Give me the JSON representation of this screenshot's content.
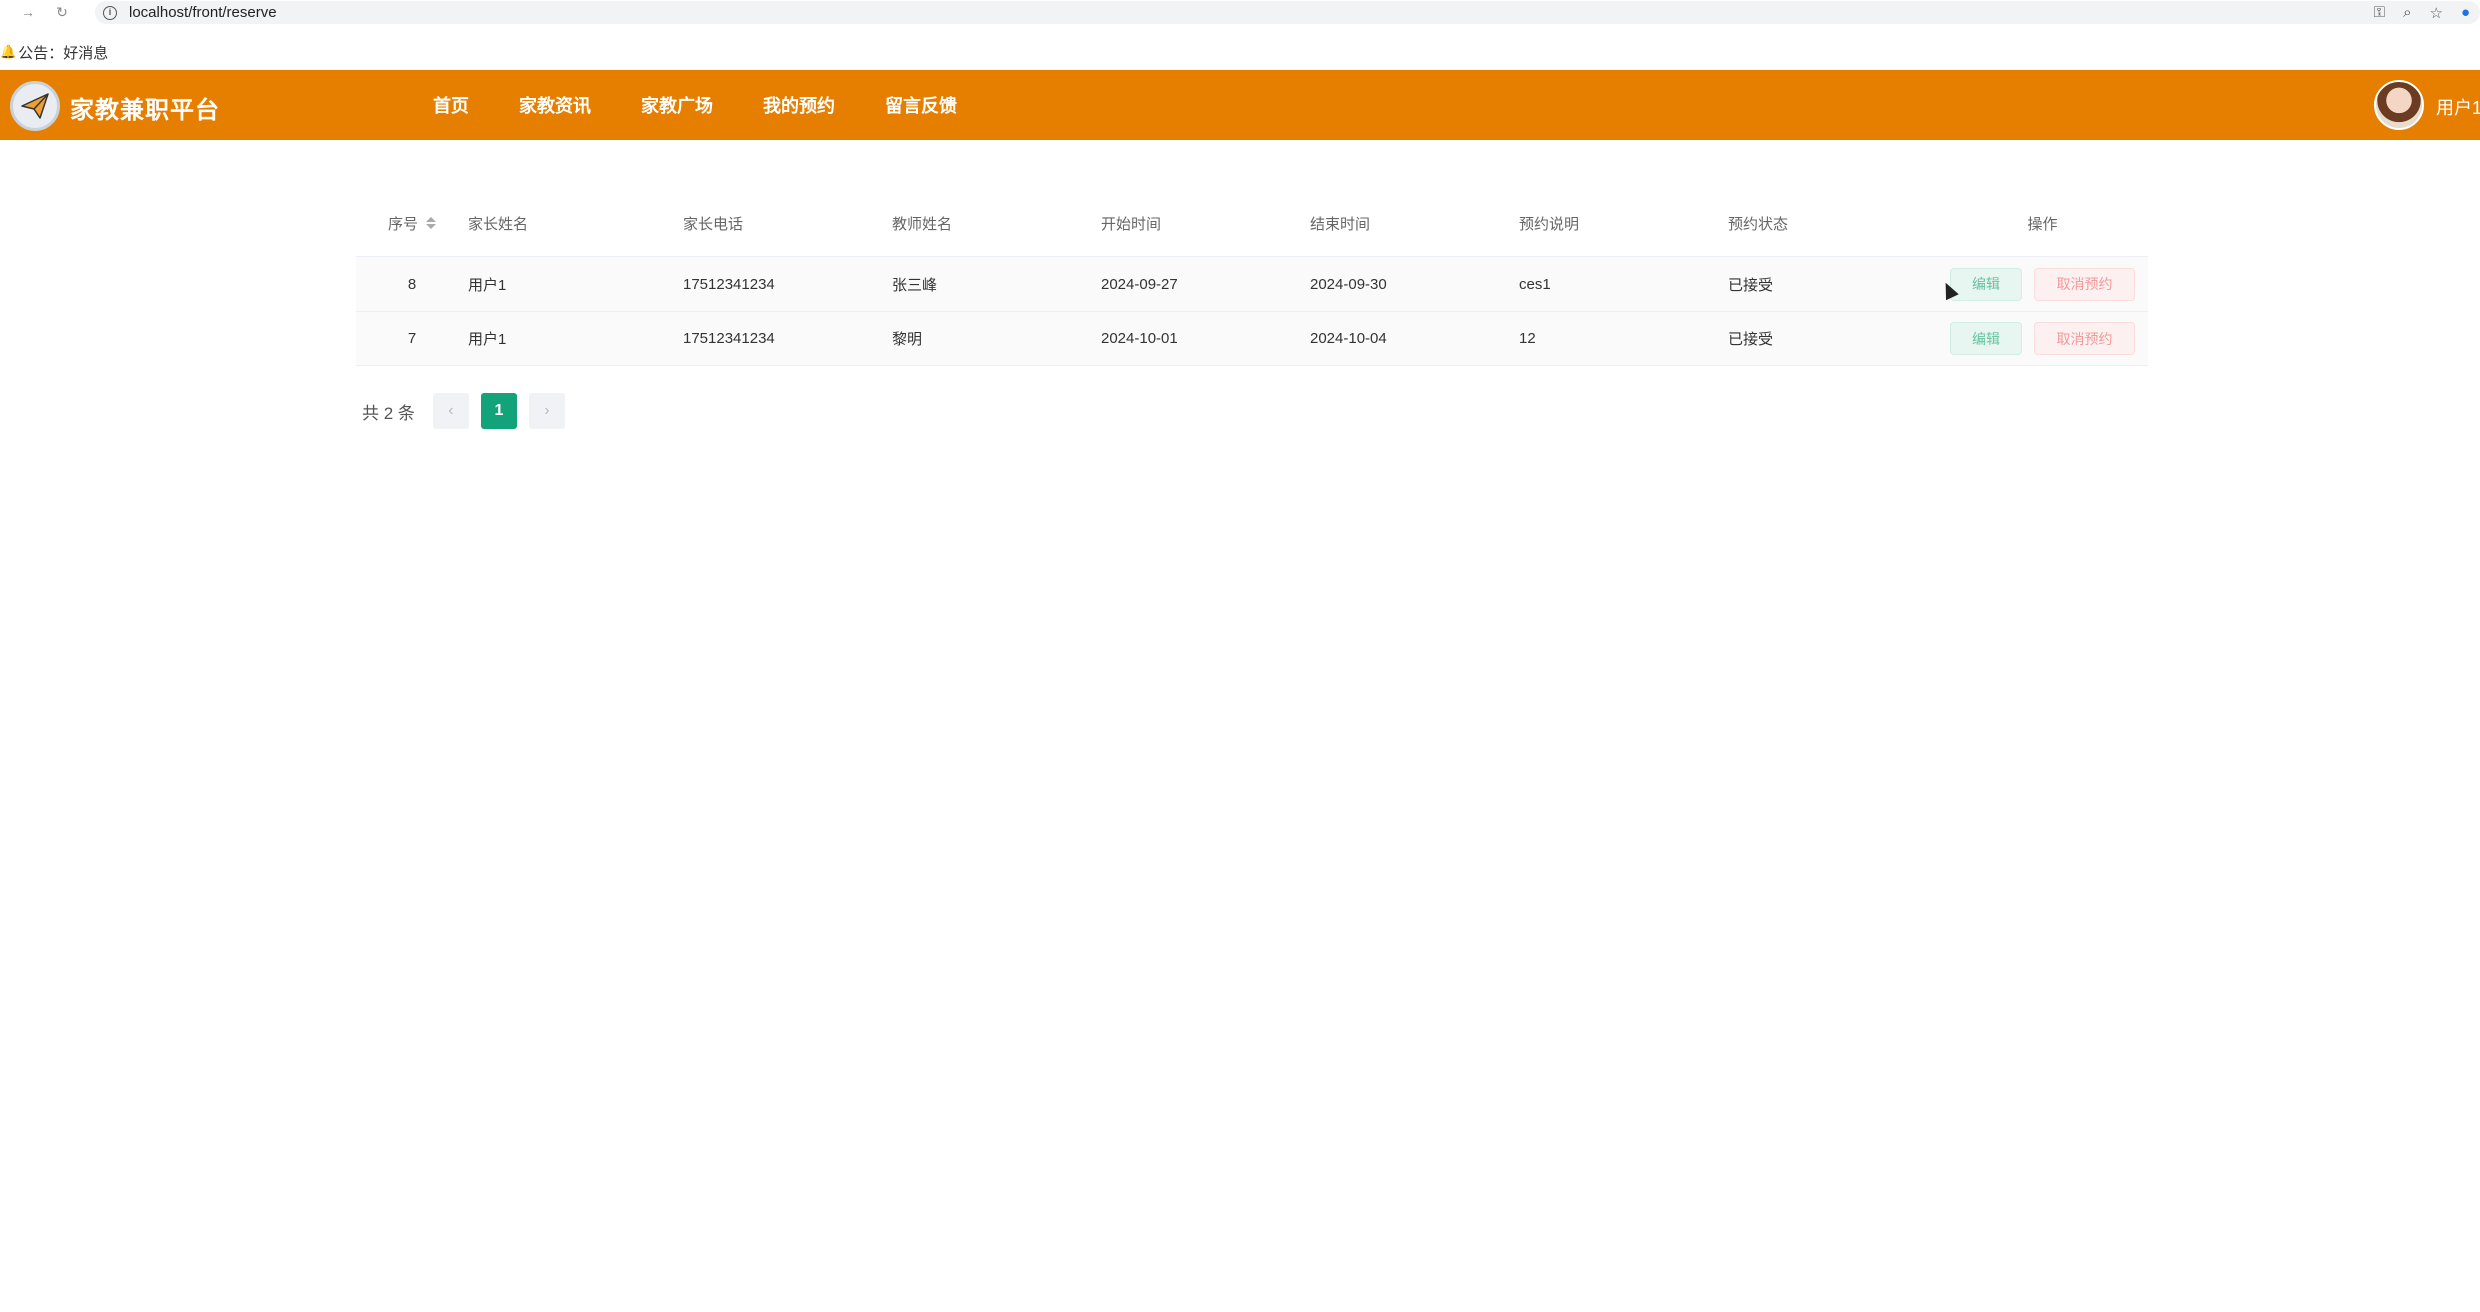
{
  "browser": {
    "url": "localhost/front/reserve",
    "back_icon": "→",
    "reload_icon": "↻"
  },
  "notice": {
    "text": "公告：好消息"
  },
  "header": {
    "title": "家教兼职平台",
    "nav": [
      {
        "label": "首页"
      },
      {
        "label": "家教资讯"
      },
      {
        "label": "家教广场"
      },
      {
        "label": "我的预约"
      },
      {
        "label": "留言反馈"
      }
    ],
    "username": "用户1",
    "accent_color": "#e67e00"
  },
  "table": {
    "columns": [
      "序号",
      "家长姓名",
      "家长电话",
      "教师姓名",
      "开始时间",
      "结束时间",
      "预约说明",
      "预约状态",
      "操作"
    ],
    "rows": [
      {
        "idx": "8",
        "parent_name": "用户1",
        "parent_phone": "17512341234",
        "teacher_name": "张三峰",
        "start": "2024-09-27",
        "end": "2024-09-30",
        "desc": "ces1",
        "status": "已接受",
        "edit_label": "编辑",
        "cancel_label": "取消预约"
      },
      {
        "idx": "7",
        "parent_name": "用户1",
        "parent_phone": "17512341234",
        "teacher_name": "黎明",
        "start": "2024-10-01",
        "end": "2024-10-04",
        "desc": "12",
        "status": "已接受",
        "edit_label": "编辑",
        "cancel_label": "取消预约"
      }
    ]
  },
  "pagination": {
    "total_text": "共 2 条",
    "prev": "‹",
    "current": "1",
    "next": "›"
  }
}
